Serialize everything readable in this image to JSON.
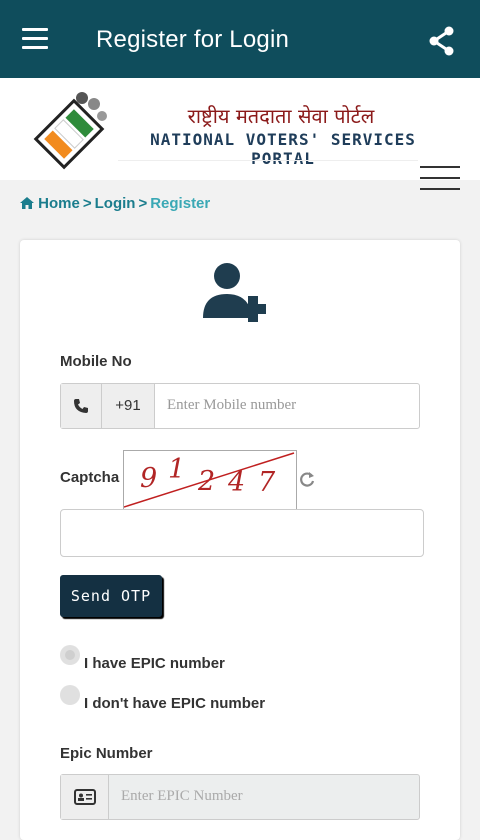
{
  "appbar": {
    "title": "Register for Login"
  },
  "portal": {
    "hindi_name": "राष्ट्रीय मतदाता सेवा पोर्टल",
    "english_name": "NATIONAL VOTERS' SERVICES PORTAL"
  },
  "breadcrumb": {
    "home": "Home",
    "login": "Login",
    "current": "Register",
    "separator": ">"
  },
  "form": {
    "mobile_label": "Mobile No",
    "country_code": "+91",
    "mobile_placeholder": "Enter Mobile number",
    "captcha_label": "Captcha",
    "captcha_chars": [
      "9",
      "1",
      "2",
      "4",
      "7"
    ],
    "captcha_value": "",
    "send_otp_label": "Send OTP",
    "radio_have_epic": "I have EPIC number",
    "radio_no_epic": "I don't have EPIC number",
    "selected_option": "have_epic",
    "epic_label": "Epic Number",
    "epic_placeholder": "Enter EPIC Number"
  },
  "colors": {
    "appbar": "#0f4d5c",
    "link": "#1b7d8d",
    "button": "#143042",
    "icon": "#1f3d4f"
  },
  "icons": [
    "menu-icon",
    "share-icon",
    "hamburger-icon",
    "home-icon",
    "add-user-icon",
    "phone-icon",
    "refresh-icon",
    "id-card-icon"
  ]
}
